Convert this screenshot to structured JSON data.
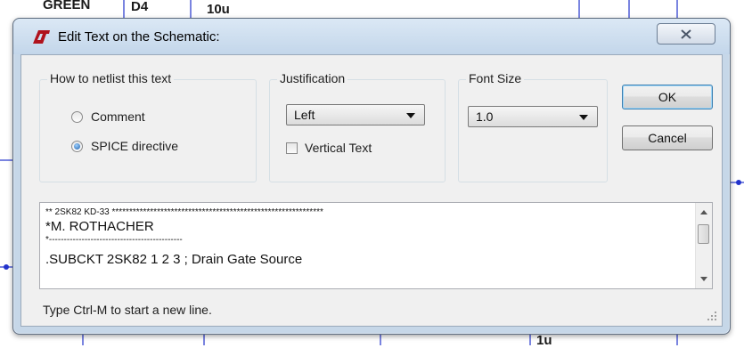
{
  "background": {
    "labels": [
      "GREEN",
      "D4",
      "10u"
    ],
    "bottom_label": "1u"
  },
  "window": {
    "title": "Edit Text on the Schematic:"
  },
  "netlist_group": {
    "label": "How to netlist this text",
    "options": [
      {
        "label": "Comment",
        "selected": false
      },
      {
        "label": "SPICE directive",
        "selected": true
      }
    ]
  },
  "justification_group": {
    "label": "Justification",
    "selected": "Left",
    "vertical_text_label": "Vertical Text",
    "vertical_text_checked": false
  },
  "font_size_group": {
    "label": "Font Size",
    "selected": "1.0"
  },
  "buttons": {
    "ok": "OK",
    "cancel": "Cancel"
  },
  "editor": {
    "lines": [
      "** 2SK82 KD-33 *************************************************************",
      "*M. ROTHACHER",
      "*---------------------------------------------",
      ".SUBCKT 2SK82 1 2 3 ; Drain Gate Source"
    ]
  },
  "hint": "Type Ctrl-M to start a new line.",
  "colors": {
    "dialog_frame": "#c6d7e8",
    "client": "#f0f0f0",
    "schematic_wire": "#1f2fbf",
    "app_icon_red": "#b0121c"
  }
}
